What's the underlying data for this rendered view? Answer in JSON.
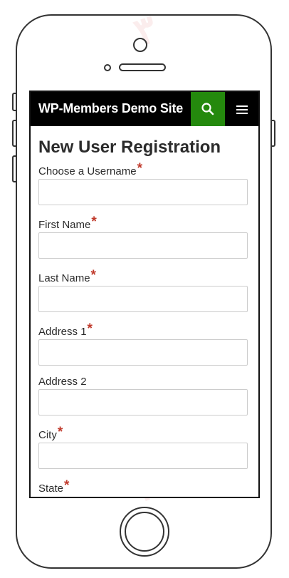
{
  "header": {
    "site_title": "WP-Members Demo Site"
  },
  "page": {
    "title": "New User Registration"
  },
  "form": {
    "required_marker": "*",
    "fields": [
      {
        "label": "Choose a Username",
        "required": true,
        "value": ""
      },
      {
        "label": "First Name",
        "required": true,
        "value": ""
      },
      {
        "label": "Last Name",
        "required": true,
        "value": ""
      },
      {
        "label": "Address 1",
        "required": true,
        "value": ""
      },
      {
        "label": "Address 2",
        "required": false,
        "value": ""
      },
      {
        "label": "City",
        "required": true,
        "value": ""
      },
      {
        "label": "State",
        "required": true,
        "value": ""
      }
    ]
  },
  "icons": {
    "search": "search-icon",
    "menu": "hamburger-menu-icon"
  },
  "colors": {
    "topbar": "#000000",
    "search_button": "#24890d",
    "required": "#c0392b",
    "text": "#2b2b2b"
  }
}
